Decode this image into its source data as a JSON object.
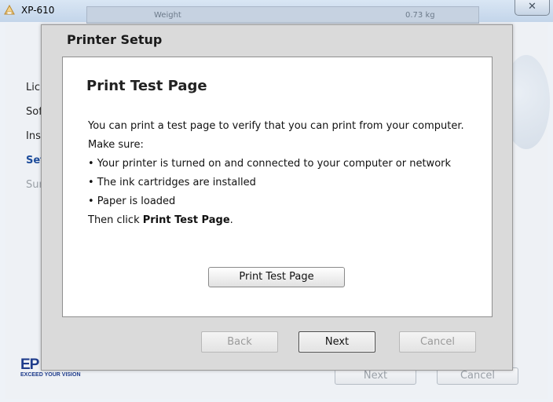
{
  "parent_window": {
    "title": "XP-610",
    "header_strip": {
      "col1": "Weight",
      "col2": "0.73 kg"
    },
    "close_glyph": "✕",
    "side_nav": [
      {
        "label": "Lic",
        "state": "normal"
      },
      {
        "label": "Sof",
        "state": "normal"
      },
      {
        "label": "Ins",
        "state": "normal"
      },
      {
        "label": "Set",
        "state": "current"
      },
      {
        "label": "Sur",
        "state": "disabled"
      }
    ],
    "logo_text": "EP",
    "logo_tagline": "EXCEED YOUR VISION",
    "buttons": {
      "next": "Next",
      "cancel": "Cancel"
    }
  },
  "dialog": {
    "title": "Printer Setup",
    "heading": "Print Test Page",
    "intro": "You can print a test page to verify that you can print from your computer.",
    "make_sure": "Make sure:",
    "bullets": [
      "• Your printer is turned on and connected to your computer or network",
      "• The ink cartridges are installed",
      "• Paper is loaded"
    ],
    "then_click_prefix": "Then click ",
    "then_click_bold": "Print Test Page",
    "then_click_suffix": ".",
    "print_test_button": "Print Test Page",
    "buttons": {
      "back": "Back",
      "next": "Next",
      "cancel": "Cancel"
    }
  },
  "colors": {
    "dialog_bg": "#dadada",
    "panel_bg": "#ffffff",
    "nav_current": "#1e4d9b",
    "brand_blue": "#1e3c8c"
  }
}
